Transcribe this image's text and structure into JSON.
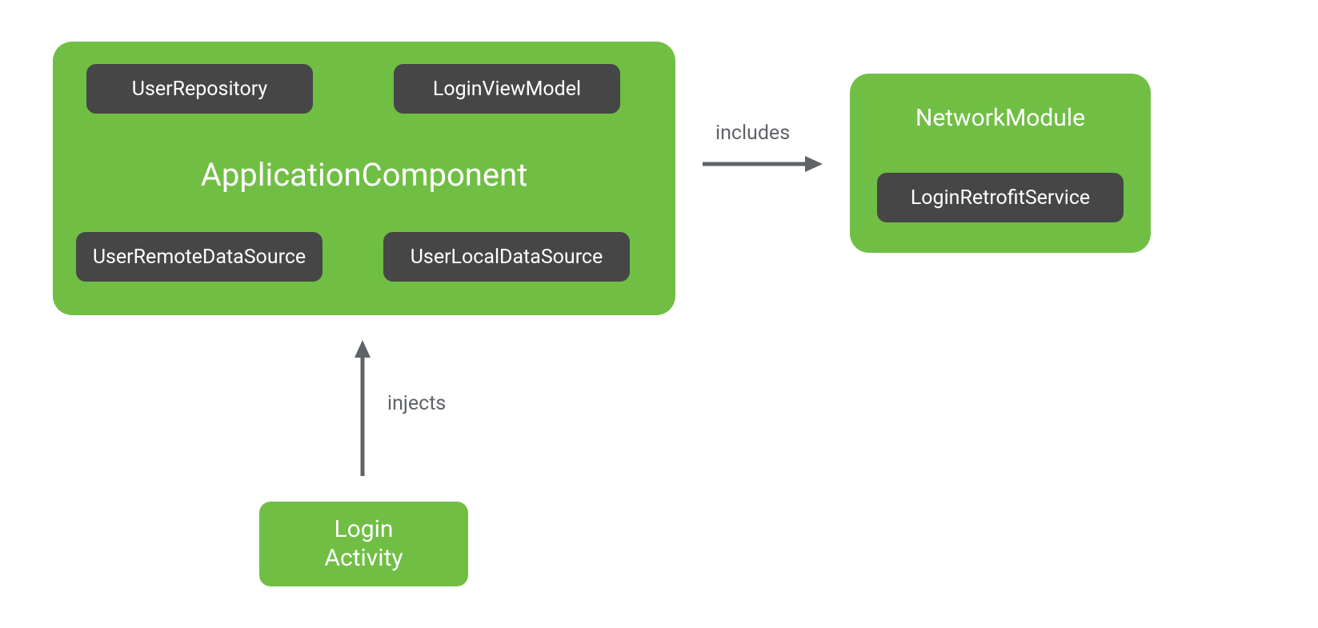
{
  "app_component": {
    "title": "ApplicationComponent",
    "items": {
      "user_repository": "UserRepository",
      "login_view_model": "LoginViewModel",
      "user_remote_ds": "UserRemoteDataSource",
      "user_local_ds": "UserLocalDataSource"
    }
  },
  "network_module": {
    "title": "NetworkModule",
    "items": {
      "login_retrofit_service": "LoginRetrofitService"
    }
  },
  "login_activity": {
    "line1": "Login",
    "line2": "Activity"
  },
  "arrows": {
    "includes": "includes",
    "injects": "injects"
  },
  "colors": {
    "green": "#70bf44",
    "dark": "#464646",
    "arrow": "#5f6367",
    "white": "#ffffff"
  }
}
